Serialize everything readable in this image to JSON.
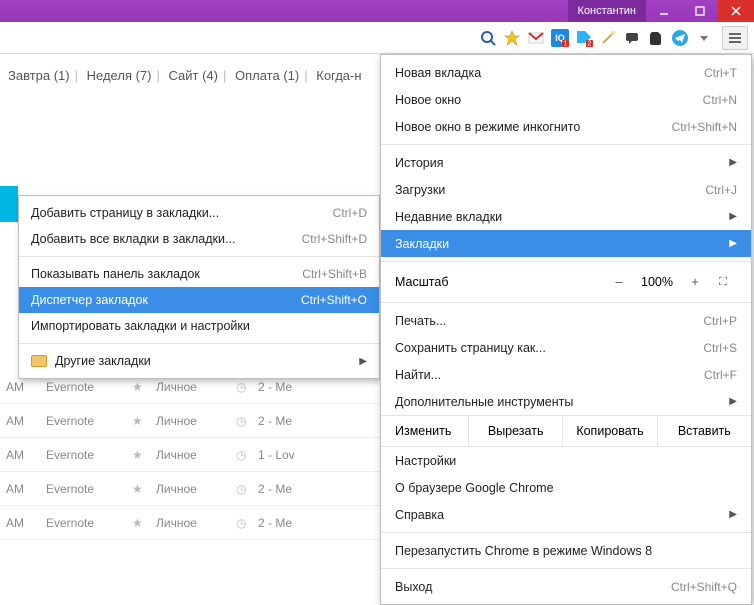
{
  "window": {
    "user": "Константин"
  },
  "tabs": {
    "items": [
      "Завтра (1)",
      "Неделя (7)",
      "Сайт (4)",
      "Оплата (1)",
      "Когда-н"
    ]
  },
  "tasklist": {
    "rows": [
      {
        "time": "AM",
        "app": "Evernote",
        "cat": "Личное",
        "when": "2 - Me"
      },
      {
        "time": "AM",
        "app": "Evernote",
        "cat": "Личное",
        "when": "2 - Me"
      },
      {
        "time": "AM",
        "app": "Evernote",
        "cat": "Личное",
        "when": "1 - Lov"
      },
      {
        "time": "AM",
        "app": "Evernote",
        "cat": "Личное",
        "when": "2 - Me"
      },
      {
        "time": "AM",
        "app": "Evernote",
        "cat": "Личное",
        "when": "2 - Me"
      }
    ]
  },
  "submenu": {
    "items": [
      {
        "label": "Добавить страницу в закладки...",
        "shortcut": "Ctrl+D"
      },
      {
        "label": "Добавить все вкладки в закладки...",
        "shortcut": "Ctrl+Shift+D"
      }
    ],
    "items2": [
      {
        "label": "Показывать панель закладок",
        "shortcut": "Ctrl+Shift+B"
      },
      {
        "label": "Диспетчер закладок",
        "shortcut": "Ctrl+Shift+O",
        "selected": true
      },
      {
        "label": "Импортировать закладки и настройки",
        "shortcut": ""
      }
    ],
    "other_bookmarks": "Другие закладки"
  },
  "mainmenu": {
    "group1": [
      {
        "label": "Новая вкладка",
        "shortcut": "Ctrl+T"
      },
      {
        "label": "Новое окно",
        "shortcut": "Ctrl+N"
      },
      {
        "label": "Новое окно в режиме инкогнито",
        "shortcut": "Ctrl+Shift+N"
      }
    ],
    "group2": [
      {
        "label": "История",
        "shortcut": "",
        "arrow": true
      },
      {
        "label": "Загрузки",
        "shortcut": "Ctrl+J"
      },
      {
        "label": "Недавние вкладки",
        "shortcut": "",
        "arrow": true
      },
      {
        "label": "Закладки",
        "shortcut": "",
        "arrow": true,
        "selected": true
      }
    ],
    "zoom": {
      "label": "Масштаб",
      "minus": "–",
      "value": "100%",
      "plus": "+"
    },
    "group3": [
      {
        "label": "Печать...",
        "shortcut": "Ctrl+P"
      },
      {
        "label": "Сохранить страницу как...",
        "shortcut": "Ctrl+S"
      },
      {
        "label": "Найти...",
        "shortcut": "Ctrl+F"
      },
      {
        "label": "Дополнительные инструменты",
        "shortcut": "",
        "arrow": true
      }
    ],
    "edit": {
      "label": "Изменить",
      "cut": "Вырезать",
      "copy": "Копировать",
      "paste": "Вставить"
    },
    "group4": [
      {
        "label": "Настройки",
        "shortcut": ""
      },
      {
        "label": "О браузере Google Chrome",
        "shortcut": ""
      },
      {
        "label": "Справка",
        "shortcut": "",
        "arrow": true
      }
    ],
    "group5": [
      {
        "label": "Перезапустить Chrome в режиме Windows 8",
        "shortcut": ""
      }
    ],
    "group6": [
      {
        "label": "Выход",
        "shortcut": "Ctrl+Shift+Q"
      }
    ]
  },
  "colors": {
    "accent": "#3a8ee6",
    "titlebar": "#9838b8",
    "close": "#d9302c"
  }
}
